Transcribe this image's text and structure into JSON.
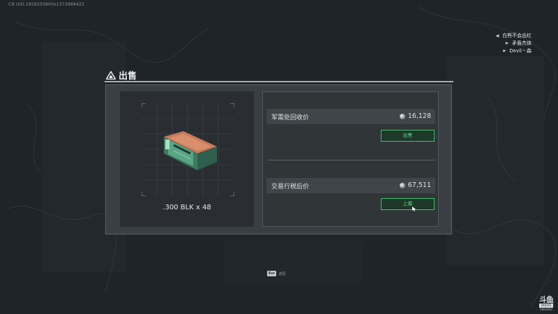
{
  "header": {
    "uid": "CN UID:1858255800x1373988422"
  },
  "team": {
    "members": [
      {
        "name": "白熊不会出红",
        "icon": "speaker-icon"
      },
      {
        "name": "矛盾杰体",
        "icon": "hand-icon"
      },
      {
        "name": "Devil丶森",
        "icon": "hand-icon"
      }
    ]
  },
  "dialog": {
    "title": "出售"
  },
  "item": {
    "name": ".300 BLK x 48"
  },
  "sell": {
    "label": "军需处回收价",
    "value": "16,128",
    "button": "出售"
  },
  "list": {
    "label": "交易行税后价",
    "value": "67,511",
    "button": "上架"
  },
  "footer": {
    "esc_key": "Esc",
    "esc_label": "返回"
  },
  "watermark": {
    "logo": "斗鱼",
    "tag": "DOUYU",
    "room": "9984860"
  },
  "colors": {
    "accent_green": "#3cc46d",
    "panel": "#3e4448",
    "background": "#1f2428"
  }
}
